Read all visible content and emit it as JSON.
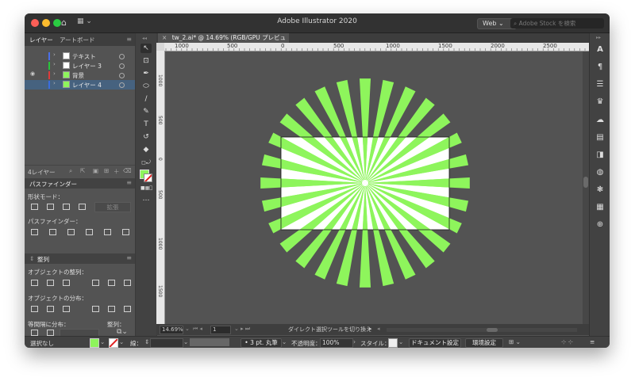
{
  "app": {
    "title": "Adobe Illustrator 2020",
    "workspace": "Web",
    "stock_search_placeholder": "Adobe Stock を検索"
  },
  "layers_panel": {
    "tabs": [
      "レイヤー",
      "アートボード"
    ],
    "layers": [
      {
        "name": "テキスト",
        "color": "#4a6fe8",
        "visible": false,
        "selected": false
      },
      {
        "name": "レイヤー 3",
        "color": "#29c53b",
        "visible": false,
        "selected": false
      },
      {
        "name": "背景",
        "color": "#e03a3a",
        "visible": true,
        "selected": false
      },
      {
        "name": "レイヤー 4",
        "color": "#3a6de0",
        "visible": false,
        "selected": true
      }
    ],
    "footer_count": "4レイヤー"
  },
  "pathfinder_panel": {
    "title": "パスファインダー",
    "shape_modes_label": "形状モード：",
    "expand_label": "拡張",
    "pathfinders_label": "パスファインダー："
  },
  "align_panel": {
    "title": "整列",
    "align_objects_label": "オブジェクトの整列：",
    "distribute_objects_label": "オブジェクトの分布：",
    "distribute_spacing_label": "等間隔に分布：",
    "align_to_label": "整列："
  },
  "document": {
    "tab_title": "tw_2.ai* @ 14.69% (RGB/GPU プレビュー)",
    "ruler_h_labels": [
      "1000",
      "500",
      "0",
      "500",
      "1000",
      "1500",
      "2000",
      "2500"
    ],
    "ruler_v_labels": [
      "1000",
      "500",
      "0",
      "500",
      "1000",
      "1500"
    ]
  },
  "artwork": {
    "ray_color": "#8ef55c",
    "ray_count": 28,
    "artboard_fill": "#ffffff"
  },
  "status_bar": {
    "zoom": "14.69%",
    "artboard_number": "1",
    "tool_hint": "ダイレクト選択ツールを切り換え"
  },
  "control_bar": {
    "selection": "選択なし",
    "fill_color": "#8ef55c",
    "stroke_label": "線：",
    "brush_label": "3 pt. 丸筆",
    "opacity_label": "不透明度：",
    "opacity_value": "100%",
    "style_label": "スタイル：",
    "doc_setup_button": "ドキュメント設定",
    "preferences_button": "環境設定"
  }
}
